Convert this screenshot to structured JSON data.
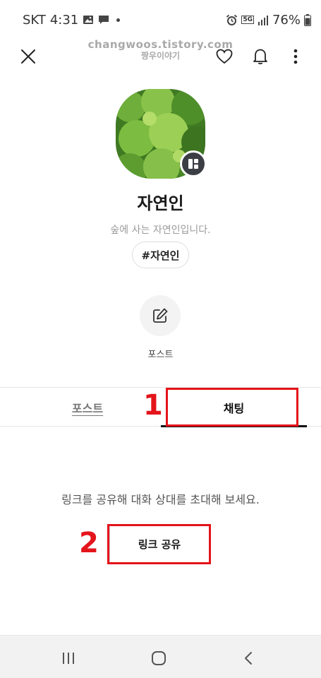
{
  "status_bar": {
    "carrier": "SKT",
    "time": "4:31",
    "network": "5G",
    "battery": "76%",
    "icons_left": [
      "image-icon",
      "message-icon",
      "dot-icon"
    ],
    "icons_right": [
      "alarm-icon",
      "5g-icon",
      "signal-icon",
      "battery-icon"
    ]
  },
  "watermark": {
    "url": "changwoos.tistory.com",
    "name": "짱우이야기"
  },
  "top_bar": {
    "icons": [
      "close-icon",
      "heart-icon",
      "bell-icon",
      "more-vertical-icon"
    ]
  },
  "profile": {
    "name": "자연인",
    "bio": "숲에 사는 자연인입니다.",
    "hashtag": "#자연인",
    "write_label": "포스트",
    "avatar_color": "#5c9a2e",
    "badge_icon": "blog-icon"
  },
  "tabs": [
    {
      "label": "포스트",
      "active": false
    },
    {
      "label": "채팅",
      "active": true
    }
  ],
  "chat": {
    "empty_message": "링크를 공유해 대화 상대를 초대해 보세요.",
    "share_button": "링크 공유"
  },
  "annotations": {
    "first": "1",
    "second": "2",
    "color": "#e4141b"
  },
  "nav_bar": {
    "icons": [
      "recents-icon",
      "home-icon",
      "back-icon"
    ]
  }
}
